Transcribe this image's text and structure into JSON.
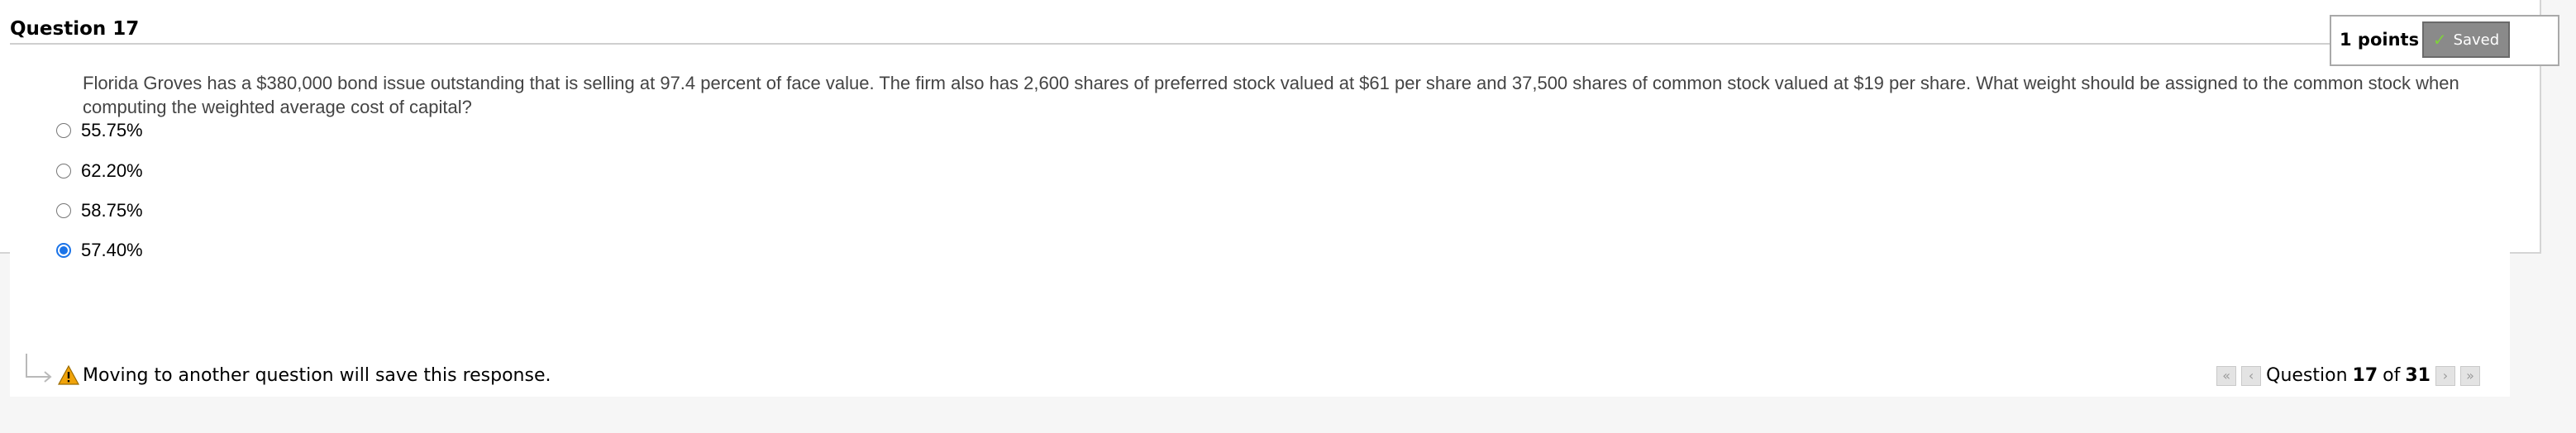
{
  "question": {
    "title": "Question 17",
    "points": "1 points",
    "saved_label": "Saved",
    "text": "Florida Groves has a $380,000 bond issue outstanding that is selling at 97.4 percent of face value. The firm also has 2,600 shares of preferred stock valued at $61 per share and 37,500 shares of common stock valued at $19 per share. What weight should be assigned to the common stock when computing the weighted average cost of capital?",
    "options": [
      {
        "label": "55.75%",
        "selected": false
      },
      {
        "label": "62.20%",
        "selected": false
      },
      {
        "label": "58.75%",
        "selected": false
      },
      {
        "label": "57.40%",
        "selected": true
      }
    ]
  },
  "footer": {
    "save_message": "Moving to another question will save this response.",
    "pager_prefix": "Question",
    "current": "17",
    "of_label": "of",
    "total": "31"
  },
  "colors": {
    "radio_selected": "#1a73e8",
    "saved_badge": "#8a8a8a",
    "warning": "#f0a30a"
  }
}
